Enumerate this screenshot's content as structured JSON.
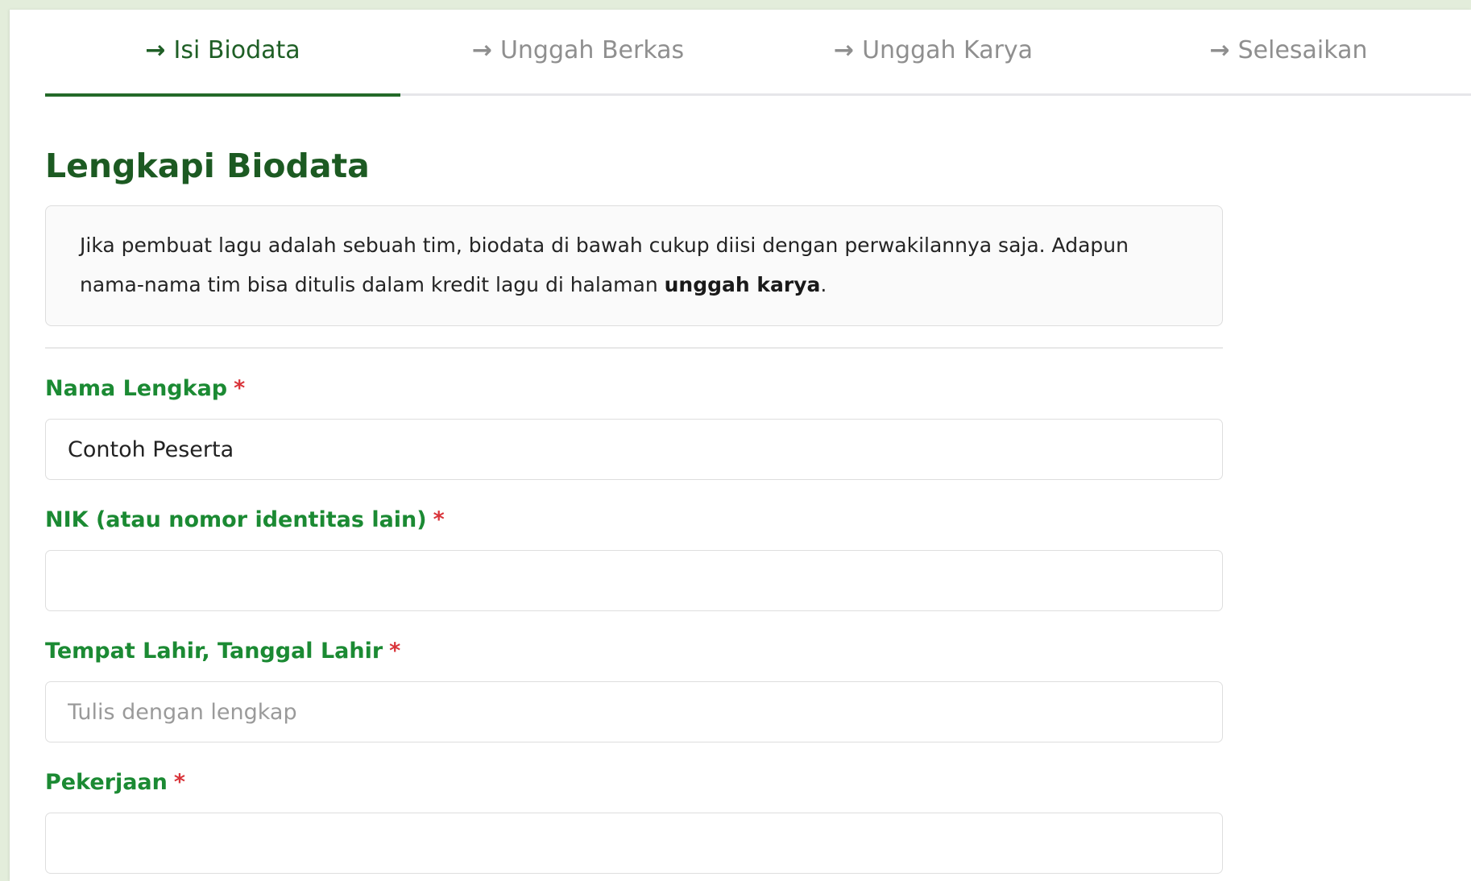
{
  "steps": [
    {
      "arrow": "→",
      "label": "Isi Biodata"
    },
    {
      "arrow": "→",
      "label": "Unggah Berkas"
    },
    {
      "arrow": "→",
      "label": "Unggah Karya"
    },
    {
      "arrow": "→",
      "label": "Selesaikan"
    }
  ],
  "active_step": "Isi Biodata",
  "page_title": "Lengkapi Biodata",
  "info": {
    "text_before": "Jika pembuat lagu adalah sebuah tim, biodata di bawah cukup diisi dengan perwakilannya saja. Adapun nama-nama tim bisa ditulis dalam kredit lagu di halaman ",
    "bold_text": "unggah karya",
    "text_after": "."
  },
  "fields": [
    {
      "label": "Nama Lengkap",
      "required_mark": "*",
      "value": "Contoh Peserta",
      "placeholder": ""
    },
    {
      "label": "NIK (atau nomor identitas lain)",
      "required_mark": "*",
      "value": "",
      "placeholder": ""
    },
    {
      "label": "Tempat Lahir, Tanggal Lahir",
      "required_mark": "*",
      "value": "",
      "placeholder": "Tulis dengan lengkap"
    },
    {
      "label": "Pekerjaan",
      "required_mark": "*",
      "value": "",
      "placeholder": ""
    }
  ],
  "colors": {
    "accent": "#236a29",
    "label": "#1b8a33",
    "required": "#d9343a",
    "background": "#e3eddb"
  }
}
